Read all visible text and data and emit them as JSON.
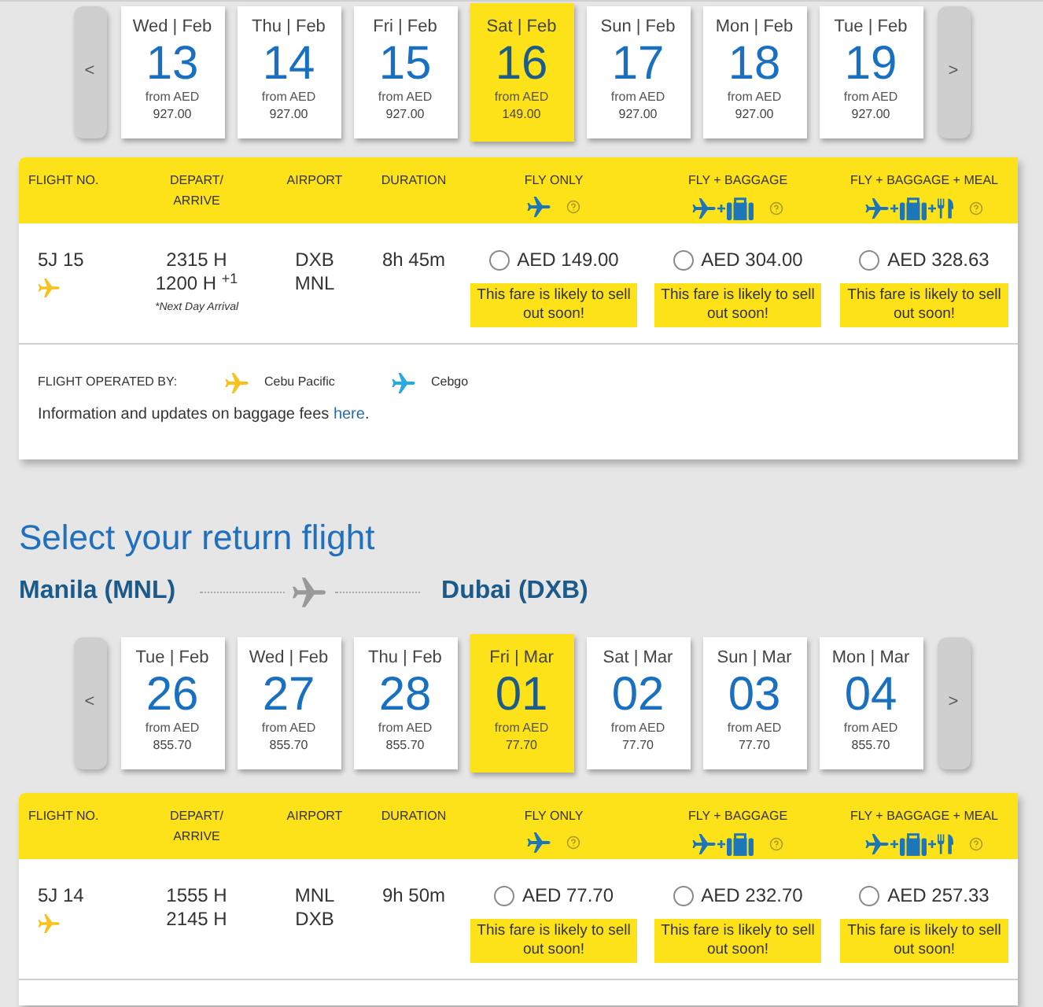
{
  "outbound": {
    "date_strip": {
      "prev": "<",
      "next": ">",
      "days": [
        {
          "label": "Wed | Feb",
          "day": "13",
          "from": "from AED",
          "price": "927.00",
          "selected": false
        },
        {
          "label": "Thu | Feb",
          "day": "14",
          "from": "from AED",
          "price": "927.00",
          "selected": false
        },
        {
          "label": "Fri | Feb",
          "day": "15",
          "from": "from AED",
          "price": "927.00",
          "selected": false
        },
        {
          "label": "Sat | Feb",
          "day": "16",
          "from": "from AED",
          "price": "149.00",
          "selected": true
        },
        {
          "label": "Sun | Feb",
          "day": "17",
          "from": "from AED",
          "price": "927.00",
          "selected": false
        },
        {
          "label": "Mon | Feb",
          "day": "18",
          "from": "from AED",
          "price": "927.00",
          "selected": false
        },
        {
          "label": "Tue | Feb",
          "day": "19",
          "from": "from AED",
          "price": "927.00",
          "selected": false
        }
      ]
    },
    "table": {
      "columns": [
        {
          "label": "FLIGHT NO."
        },
        {
          "label": "DEPART/ ARRIVE"
        },
        {
          "label": "AIRPORT"
        },
        {
          "label": "DURATION"
        },
        {
          "label": "FLY ONLY",
          "icons": [
            {
              "kind": "plane"
            }
          ]
        },
        {
          "label": "FLY + BAGGAGE",
          "icons": [
            {
              "kind": "plane"
            },
            {
              "kind": "bag"
            }
          ]
        },
        {
          "label": "FLY + BAGGAGE + MEAL",
          "icons": [
            {
              "kind": "plane"
            },
            {
              "kind": "bag"
            },
            {
              "kind": "meal"
            }
          ]
        }
      ],
      "flights": [
        {
          "number": "5J 15",
          "color": "#f7c21c",
          "depart": "2315 H",
          "arrive": "1200 H $^{+1}$",
          "note": "*Next Day Arrival",
          "airports": [
            "DXB",
            "MNL"
          ],
          "duration": "8h 45m",
          "fares": [
            {
              "price": "AED 149.00",
              "selected": false,
              "notice": "This fare is likely to sell out soon!"
            },
            {
              "price": "AED 304.00",
              "selected": false,
              "notice": "This fare is likely to sell out soon!"
            },
            {
              "price": "AED 328.63",
              "selected": false,
              "notice": "This fare is likely to sell out soon!"
            }
          ]
        }
      ]
    },
    "operated_by": {
      "label": "FLIGHT OPERATED BY:",
      "operators": [
        {
          "name": "Cebu Pacific",
          "color": "#f7c21c"
        },
        {
          "name": "Cebgo",
          "color": "#27a9e1"
        }
      ]
    },
    "baggage_info": {
      "text": "Information and updates on baggage fees",
      "link": "here",
      "end": "."
    }
  },
  "return": {
    "heading": "Select your return flight",
    "route": {
      "from": "Manila (MNL)",
      "to": "Dubai (DXB)"
    },
    "date_strip": {
      "prev": "<",
      "next": ">",
      "days": [
        {
          "label": "Tue | Feb",
          "day": "26",
          "from": "from AED",
          "price": "855.70",
          "selected": false
        },
        {
          "label": "Wed | Feb",
          "day": "27",
          "from": "from AED",
          "price": "855.70",
          "selected": false
        },
        {
          "label": "Thu | Feb",
          "day": "28",
          "from": "from AED",
          "price": "855.70",
          "selected": false
        },
        {
          "label": "Fri | Mar",
          "day": "01",
          "from": "from AED",
          "price": "77.70",
          "selected": true
        },
        {
          "label": "Sat | Mar",
          "day": "02",
          "from": "from AED",
          "price": "77.70",
          "selected": false
        },
        {
          "label": "Sun | Mar",
          "day": "03",
          "from": "from AED",
          "price": "77.70",
          "selected": false
        },
        {
          "label": "Mon | Mar",
          "day": "04",
          "from": "from AED",
          "price": "855.70",
          "selected": false
        }
      ]
    },
    "table": {
      "columns": [
        {
          "label": "FLIGHT NO."
        },
        {
          "label": "DEPART/ ARRIVE"
        },
        {
          "label": "AIRPORT"
        },
        {
          "label": "DURATION"
        },
        {
          "label": "FLY ONLY",
          "icons": [
            {
              "kind": "plane"
            }
          ]
        },
        {
          "label": "FLY + BAGGAGE",
          "icons": [
            {
              "kind": "plane"
            },
            {
              "kind": "bag"
            }
          ]
        },
        {
          "label": "FLY + BAGGAGE + MEAL",
          "icons": [
            {
              "kind": "plane"
            },
            {
              "kind": "bag"
            },
            {
              "kind": "meal"
            }
          ]
        }
      ],
      "flights": [
        {
          "number": "5J 14",
          "color": "#f7c21c",
          "depart": "1555 H",
          "arrive": "2145 H",
          "airports": [
            "MNL",
            "DXB"
          ],
          "duration": "9h 50m",
          "fares": [
            {
              "price": "AED 77.70",
              "selected": false,
              "notice": "This fare is likely to sell out soon!"
            },
            {
              "price": "AED 232.70",
              "selected": false,
              "notice": "This fare is likely to sell out soon!"
            },
            {
              "price": "AED 257.33",
              "selected": false,
              "notice": "This fare is likely to sell out soon!"
            }
          ]
        }
      ]
    }
  }
}
